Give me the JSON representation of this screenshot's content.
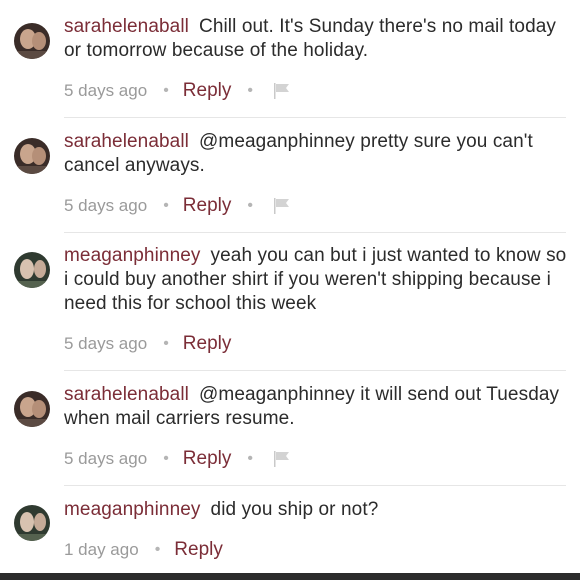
{
  "comments": [
    {
      "user": "sarahelenaball",
      "text": "Chill out. It's Sunday there's no mail today or tomorrow because of the holiday.",
      "time": "5 days ago",
      "dot": "•",
      "reply": "Reply",
      "avatar": "avatar-sarah",
      "has_flag": true
    },
    {
      "user": "sarahelenaball",
      "text": "@meaganphinney pretty sure you can't cancel anyways.",
      "time": "5 days ago",
      "dot": "•",
      "reply": "Reply",
      "avatar": "avatar-sarah",
      "has_flag": true
    },
    {
      "user": "meaganphinney",
      "text": "yeah you can but i just wanted to know so i could buy another shirt if you weren't shipping because i need this for school this week",
      "time": "5 days ago",
      "dot": "•",
      "reply": "Reply",
      "avatar": "avatar-meagan",
      "has_flag": false
    },
    {
      "user": "sarahelenaball",
      "text": "@meaganphinney it will send out Tuesday when mail carriers resume.",
      "time": "5 days ago",
      "dot": "•",
      "reply": "Reply",
      "avatar": "avatar-sarah",
      "has_flag": true
    },
    {
      "user": "meaganphinney",
      "text": "did you ship or not?",
      "time": "1 day ago",
      "dot": "•",
      "reply": "Reply",
      "avatar": "avatar-meagan",
      "has_flag": false
    }
  ],
  "colors": {
    "username": "#7b2d37",
    "reply": "#7b2d37",
    "text": "#2b2b2b",
    "meta": "#9a9a9a"
  }
}
